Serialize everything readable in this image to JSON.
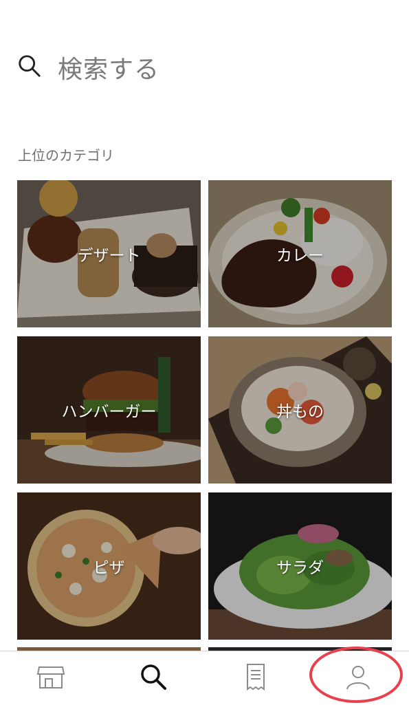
{
  "search": {
    "placeholder": "検索する",
    "icon": "search-icon"
  },
  "categories_section": {
    "title": "上位のカテゴリ",
    "items": [
      {
        "label": "デザート"
      },
      {
        "label": "カレー"
      },
      {
        "label": "ハンバーガー"
      },
      {
        "label": "丼もの"
      },
      {
        "label": "ピザ"
      },
      {
        "label": "サラダ"
      }
    ]
  },
  "tabbar": {
    "tabs": [
      {
        "icon": "store-icon",
        "active": false
      },
      {
        "icon": "search-icon",
        "active": true
      },
      {
        "icon": "receipt-icon",
        "active": false
      },
      {
        "icon": "account-icon",
        "active": false
      }
    ]
  },
  "colors": {
    "active": "#111111",
    "inactive": "#9a9a9a",
    "highlight": "#e8404c"
  }
}
